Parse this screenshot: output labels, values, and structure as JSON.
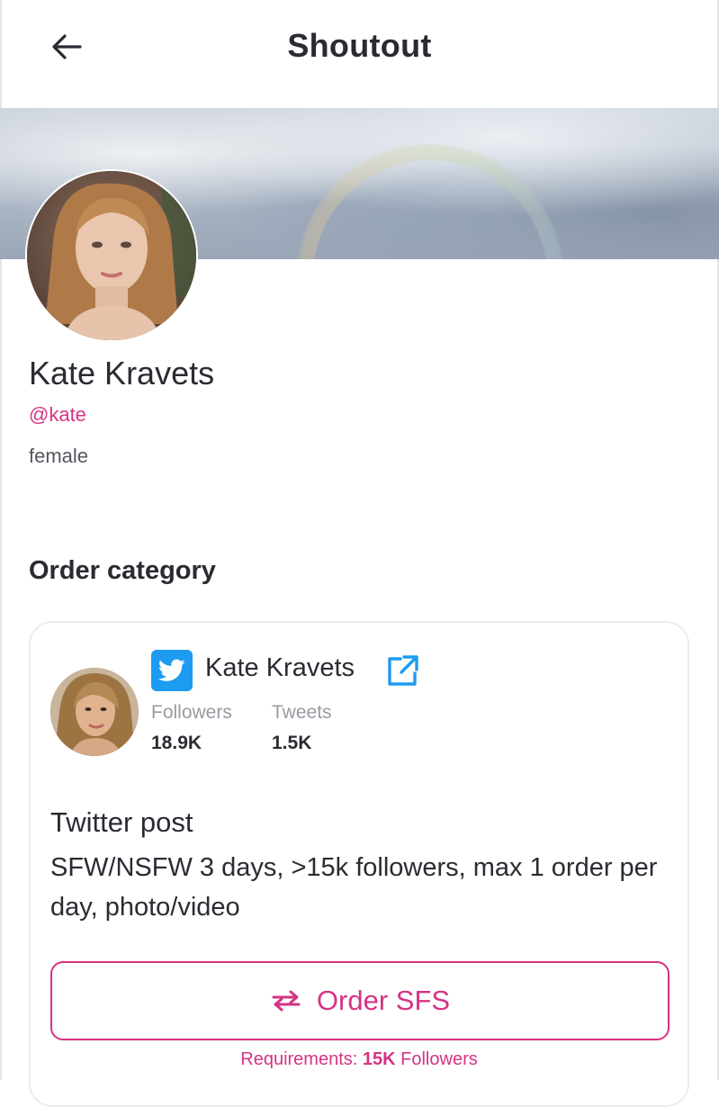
{
  "header": {
    "title": "Shoutout"
  },
  "profile": {
    "name": "Kate Kravets",
    "handle": "@kate",
    "gender": "female"
  },
  "section": {
    "order_category_title": "Order category"
  },
  "card": {
    "account_name": "Kate Kravets",
    "stats": [
      {
        "label": "Followers",
        "value": "18.9K"
      },
      {
        "label": "Tweets",
        "value": "1.5K"
      }
    ],
    "offer_title": "Twitter post",
    "offer_description": "SFW/NSFW 3 days, >15k followers, max 1 order per day, photo/video",
    "order_button_label": "Order SFS",
    "requirements_prefix": "Requirements: ",
    "requirements_value": "15K",
    "requirements_suffix": " Followers"
  },
  "icons": {
    "back": "arrow-left-icon",
    "twitter": "twitter-icon",
    "external_link": "external-link-icon",
    "swap": "swap-arrows-icon"
  },
  "colors": {
    "accent": "#d63384",
    "twitter_blue": "#1d9bf0",
    "text": "#2b2b33",
    "muted": "#9a9aa3"
  }
}
